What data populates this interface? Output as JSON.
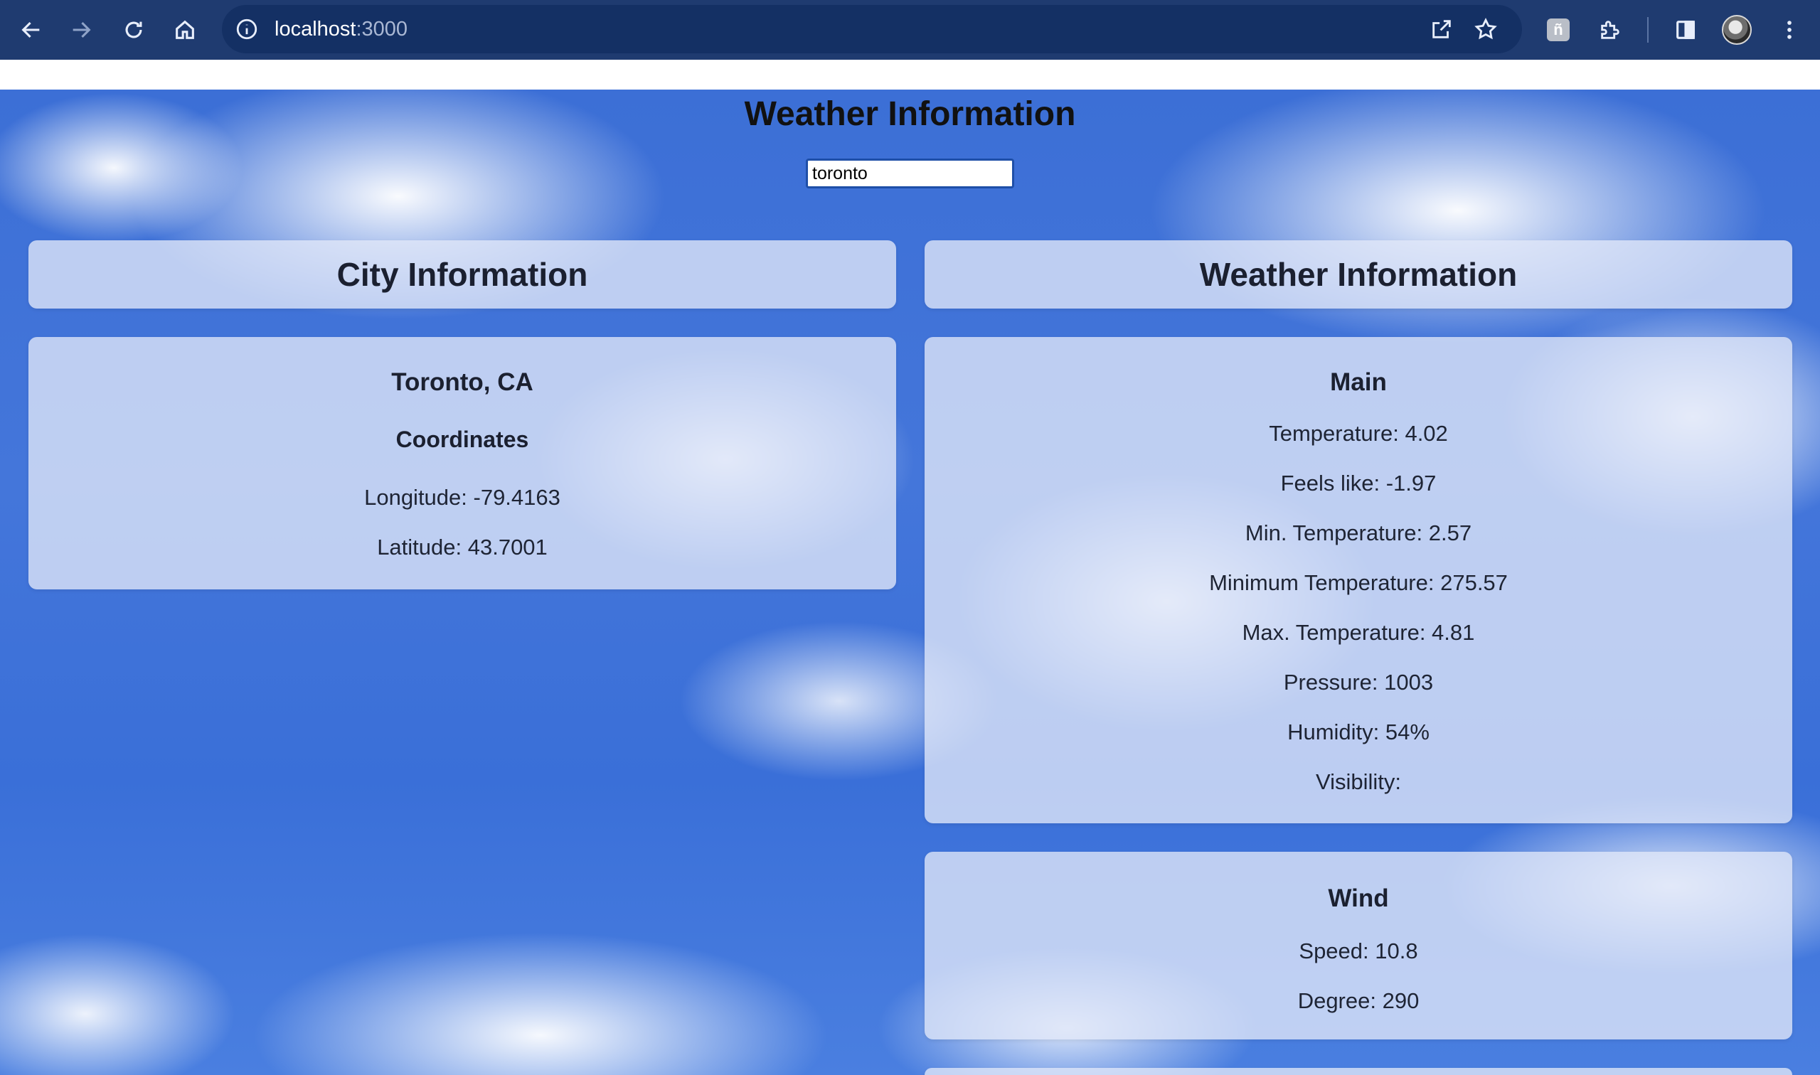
{
  "browser": {
    "url_host": "localhost",
    "url_port": ":3000",
    "extension_badge": "ñ"
  },
  "page": {
    "title": "Weather Information",
    "search": {
      "value": "toronto"
    }
  },
  "city_section": {
    "heading": "City Information",
    "city_name": "Toronto, CA",
    "coordinates_heading": "Coordinates",
    "longitude": "Longitude: -79.4163",
    "latitude": "Latitude: 43.7001"
  },
  "weather_section": {
    "heading": "Weather Information",
    "main": {
      "title": "Main",
      "lines": [
        "Temperature: 4.02",
        "Feels like: -1.97",
        "Min. Temperature: 2.57",
        "Minimum Temperature: 275.57",
        "Max. Temperature: 4.81",
        "Pressure: 1003",
        "Humidity: 54%",
        "Visibility:"
      ]
    },
    "wind": {
      "title": "Wind",
      "speed": "Speed: 10.8",
      "degree": "Degree: 290"
    }
  },
  "colors": {
    "chrome": "#1f3b70",
    "sky": "#4476da",
    "card": "#e2e8f8",
    "input_border": "#1f4fa8"
  }
}
